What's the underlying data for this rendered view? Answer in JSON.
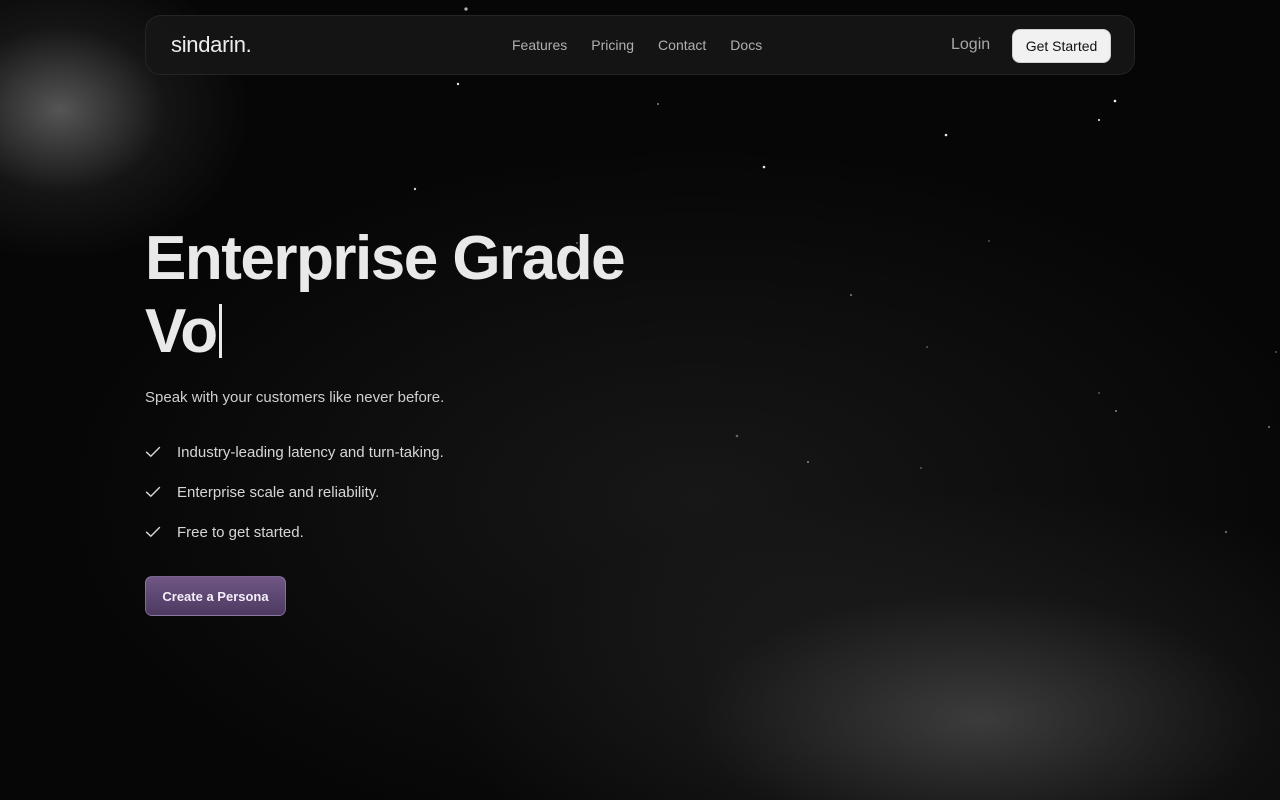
{
  "nav": {
    "logo": "sindarin.",
    "links": [
      {
        "label": "Features"
      },
      {
        "label": "Pricing"
      },
      {
        "label": "Contact"
      },
      {
        "label": "Docs"
      }
    ],
    "login_label": "Login",
    "get_started_label": "Get Started"
  },
  "hero": {
    "title_line1": "Enterprise Grade",
    "title_line2": "Vo",
    "subtitle": "Speak with your customers like never before.",
    "features": [
      {
        "text": "Industry-leading latency and turn-taking.",
        "icon": "check-icon"
      },
      {
        "text": "Enterprise scale and reliability.",
        "icon": "check-icon"
      },
      {
        "text": "Free to get started.",
        "icon": "check-icon"
      }
    ],
    "cta_label": "Create a Persona"
  },
  "colors": {
    "background": "#060606",
    "cta_accent": "#5e4874",
    "nav_bg": "#161616"
  }
}
